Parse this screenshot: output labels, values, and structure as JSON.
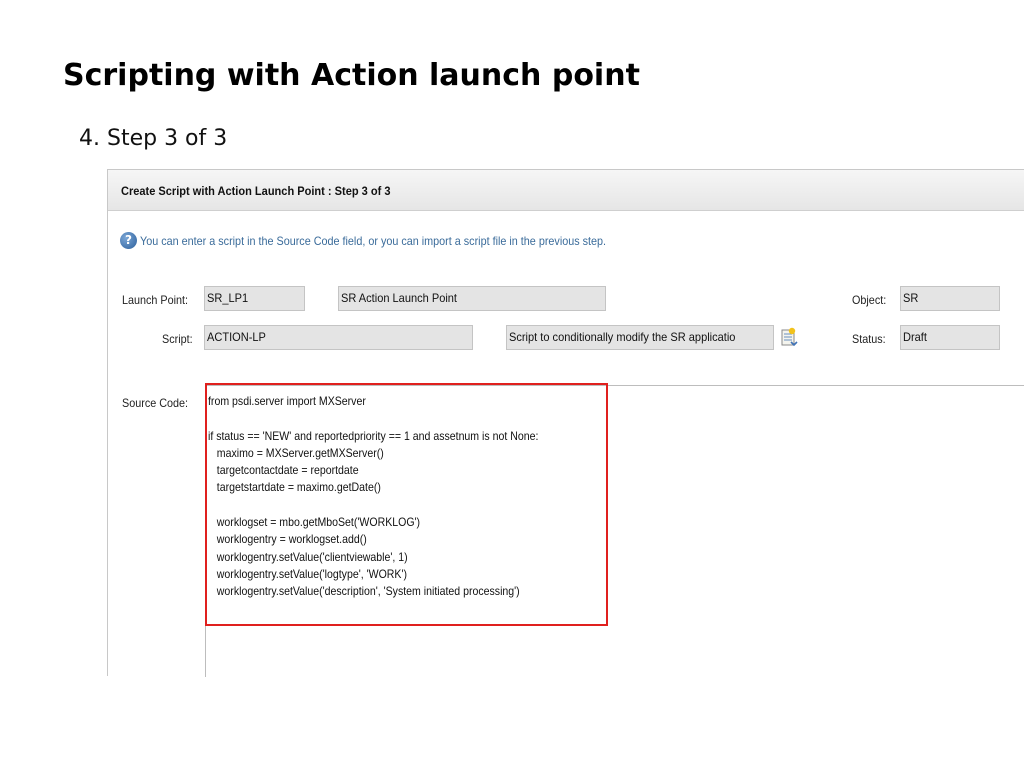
{
  "slide": {
    "title": "Scripting with Action launch point",
    "subtitle": "4. Step 3 of 3"
  },
  "dialog": {
    "title": "Create Script with Action Launch Point : Step 3 of 3",
    "info": "You can enter a script in the Source Code field, or you can import a script file in the previous step.",
    "fields": {
      "launch_point_label": "Launch Point:",
      "launch_point_value": "SR_LP1",
      "launch_point_desc": "SR Action Launch Point",
      "object_label": "Object:",
      "object_value": "SR",
      "script_label": "Script:",
      "script_value": "ACTION-LP",
      "script_desc": "Script to conditionally modify the SR applicatio",
      "status_label": "Status:",
      "status_value": "Draft",
      "source_code_label": "Source Code:"
    },
    "source_code": [
      "from psdi.server import MXServer",
      "",
      "if status == 'NEW' and reportedpriority == 1 and assetnum is not None:",
      "   maximo = MXServer.getMXServer()",
      "   targetcontactdate = reportdate",
      "   targetstartdate = maximo.getDate()",
      "",
      "   worklogset = mbo.getMboSet('WORKLOG')",
      "   worklogentry = worklogset.add()",
      "   worklogentry.setValue('clientviewable', 1)",
      "   worklogentry.setValue('logtype', 'WORK')",
      "   worklogentry.setValue('description', 'System initiated processing')"
    ]
  },
  "icons": {
    "help": "help-icon",
    "lookup": "detail-lookup-icon"
  },
  "colors": {
    "highlight": "#e0201e",
    "info_text": "#3a6b9a",
    "field_bg": "#e4e4e4"
  }
}
